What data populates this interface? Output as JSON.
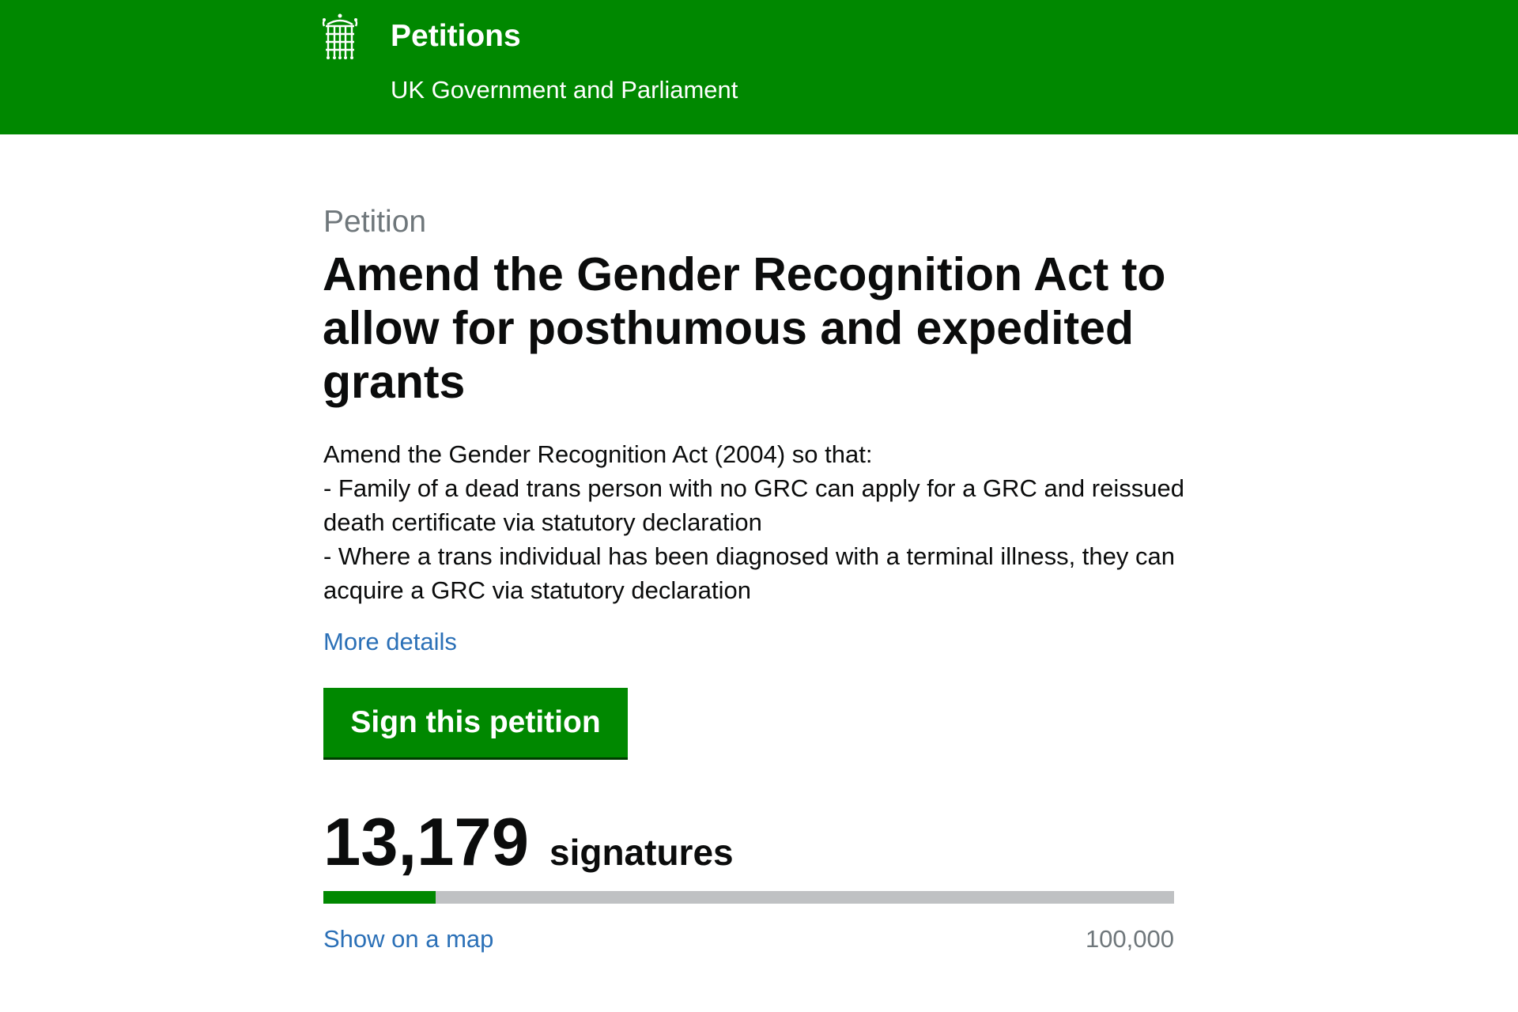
{
  "header": {
    "logo_icon": "portcullis-icon",
    "title": "Petitions",
    "subtitle": "UK Government and Parliament",
    "background_color": "#008800"
  },
  "petition": {
    "kicker": "Petition",
    "title": "Amend the Gender Recognition Act to allow for posthumous and expedited grants",
    "body_lines": [
      "Amend the Gender Recognition Act (2004) so that:",
      "- Family of a dead trans person with no GRC can apply for a GRC and reissued death certificate via statutory declaration",
      "- Where a trans individual has been diagnosed with a terminal illness, they can acquire a GRC via statutory declaration"
    ],
    "more_details_label": "More details",
    "sign_button_label": "Sign this petition"
  },
  "signatures": {
    "count": "13,179",
    "label": "signatures",
    "target": "100,000",
    "progress_fraction": 0.13179,
    "show_map_label": "Show on a map"
  },
  "colors": {
    "brand_green": "#008800",
    "link_blue": "#2b70b7",
    "progress_track": "#bfc1c3"
  }
}
